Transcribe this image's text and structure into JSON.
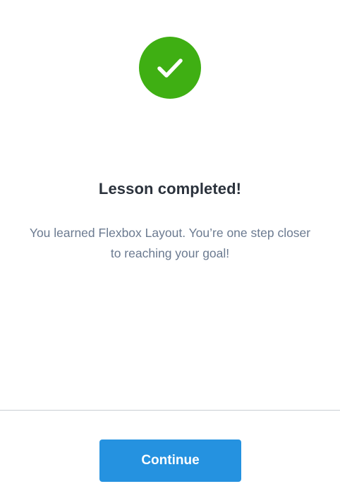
{
  "completion": {
    "icon": "check-circle-icon",
    "title": "Lesson completed!",
    "message": "You learned Flexbox Layout. You’re one step closer to reaching your goal!"
  },
  "footer": {
    "continue_label": "Continue"
  },
  "colors": {
    "success_green": "#3faf13",
    "primary_blue": "#2592e0",
    "title_text": "#2b323c",
    "body_text": "#6b7a90",
    "divider": "#c9cfd4"
  }
}
